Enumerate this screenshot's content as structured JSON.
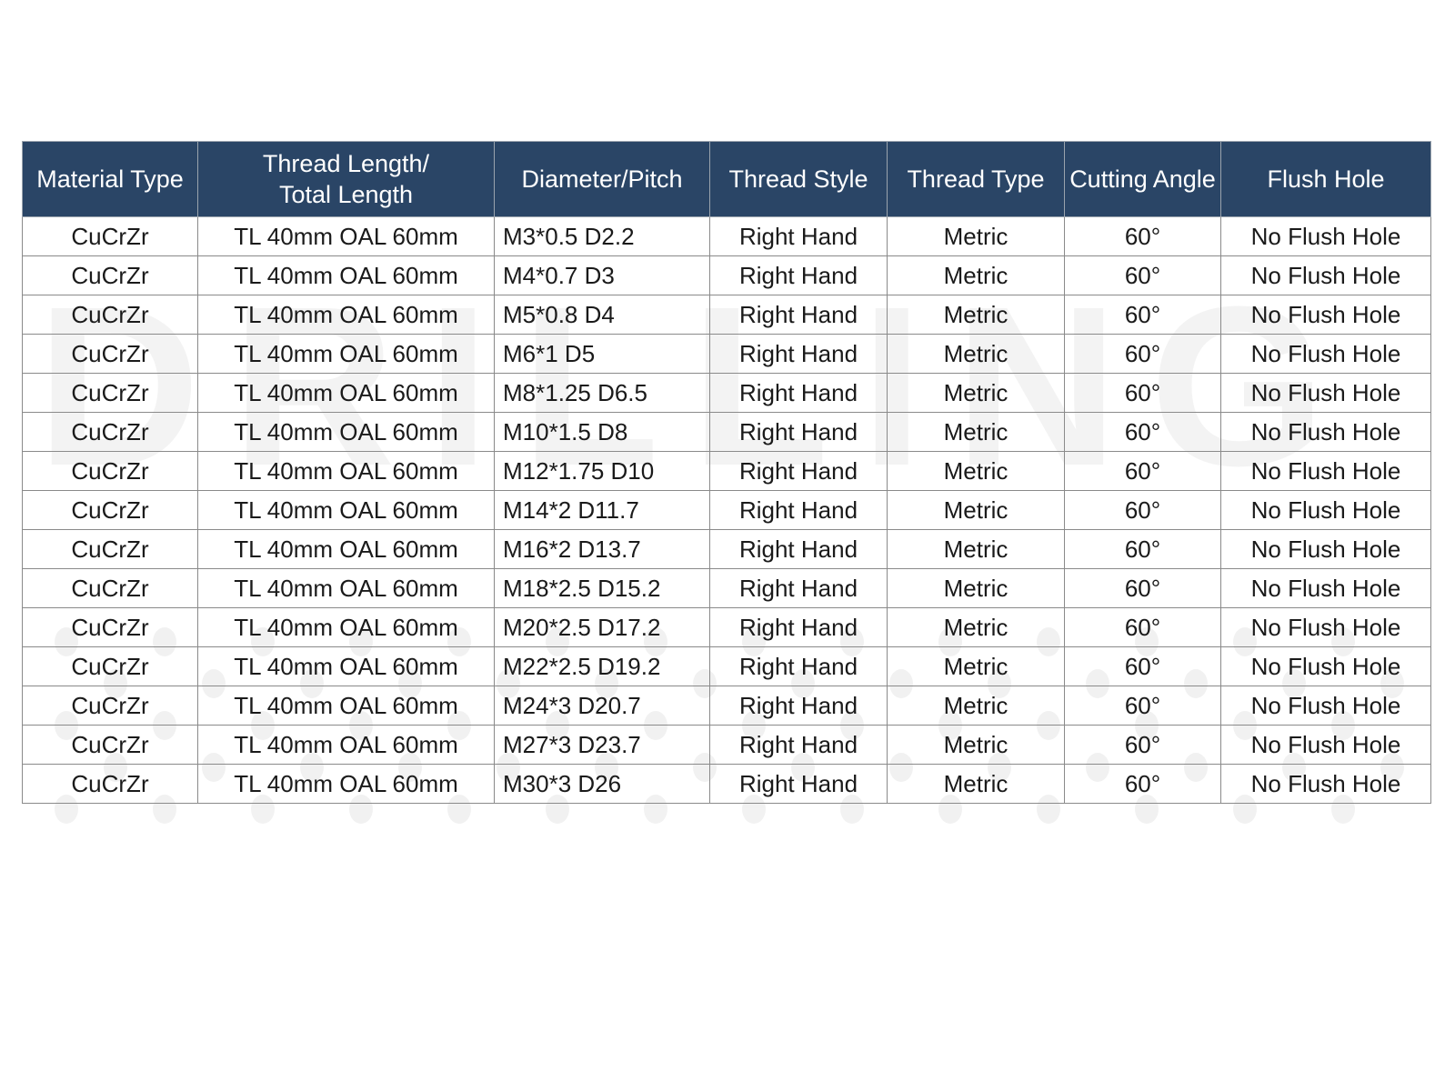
{
  "watermark": {
    "text": "DRILLING",
    "dot_pattern_label": "dot-texture"
  },
  "table": {
    "columns": [
      {
        "key": "material_type",
        "label_line1": "Material Type",
        "label_line2": "",
        "align": "center"
      },
      {
        "key": "thread_length",
        "label_line1": "Thread Length/",
        "label_line2": "Total Length",
        "align": "center"
      },
      {
        "key": "diameter_pitch",
        "label_line1": "Diameter/Pitch",
        "label_line2": "",
        "align": "left"
      },
      {
        "key": "thread_style",
        "label_line1": "Thread Style",
        "label_line2": "",
        "align": "center"
      },
      {
        "key": "thread_type",
        "label_line1": "Thread Type",
        "label_line2": "",
        "align": "center"
      },
      {
        "key": "cutting_angle",
        "label_line1": "Cutting Angle",
        "label_line2": "",
        "align": "center"
      },
      {
        "key": "flush_hole",
        "label_line1": "Flush Hole",
        "label_line2": "",
        "align": "center"
      }
    ],
    "header_bg": "#2a4566",
    "header_fg": "#ffffff",
    "border_color": "#8a8a8a",
    "rows": [
      [
        "CuCrZr",
        "TL 40mm OAL 60mm",
        "M3*0.5 D2.2",
        "Right Hand",
        "Metric",
        "60°",
        "No Flush Hole"
      ],
      [
        "CuCrZr",
        "TL 40mm OAL 60mm",
        "M4*0.7 D3",
        "Right Hand",
        "Metric",
        "60°",
        "No Flush Hole"
      ],
      [
        "CuCrZr",
        "TL 40mm OAL 60mm",
        "M5*0.8 D4",
        "Right Hand",
        "Metric",
        "60°",
        "No Flush Hole"
      ],
      [
        "CuCrZr",
        "TL 40mm OAL 60mm",
        "M6*1 D5",
        "Right Hand",
        "Metric",
        "60°",
        "No Flush Hole"
      ],
      [
        "CuCrZr",
        "TL 40mm OAL 60mm",
        "M8*1.25 D6.5",
        "Right Hand",
        "Metric",
        "60°",
        "No Flush Hole"
      ],
      [
        "CuCrZr",
        "TL 40mm OAL 60mm",
        "M10*1.5 D8",
        "Right Hand",
        "Metric",
        "60°",
        "No Flush Hole"
      ],
      [
        "CuCrZr",
        "TL 40mm OAL 60mm",
        "M12*1.75 D10",
        "Right Hand",
        "Metric",
        "60°",
        "No Flush Hole"
      ],
      [
        "CuCrZr",
        "TL 40mm OAL 60mm",
        "M14*2 D11.7",
        "Right Hand",
        "Metric",
        "60°",
        "No Flush Hole"
      ],
      [
        "CuCrZr",
        "TL 40mm OAL 60mm",
        "M16*2 D13.7",
        "Right Hand",
        "Metric",
        "60°",
        "No Flush Hole"
      ],
      [
        "CuCrZr",
        "TL 40mm OAL 60mm",
        "M18*2.5 D15.2",
        "Right Hand",
        "Metric",
        "60°",
        "No Flush Hole"
      ],
      [
        "CuCrZr",
        "TL 40mm OAL 60mm",
        "M20*2.5 D17.2",
        "Right Hand",
        "Metric",
        "60°",
        "No Flush Hole"
      ],
      [
        "CuCrZr",
        "TL 40mm OAL 60mm",
        "M22*2.5 D19.2",
        "Right Hand",
        "Metric",
        "60°",
        "No Flush Hole"
      ],
      [
        "CuCrZr",
        "TL 40mm OAL 60mm",
        "M24*3 D20.7",
        "Right Hand",
        "Metric",
        "60°",
        "No Flush Hole"
      ],
      [
        "CuCrZr",
        "TL 40mm OAL 60mm",
        "M27*3 D23.7",
        "Right Hand",
        "Metric",
        "60°",
        "No Flush Hole"
      ],
      [
        "CuCrZr",
        "TL 40mm OAL 60mm",
        "M30*3 D26",
        "Right Hand",
        "Metric",
        "60°",
        "No Flush Hole"
      ]
    ]
  }
}
